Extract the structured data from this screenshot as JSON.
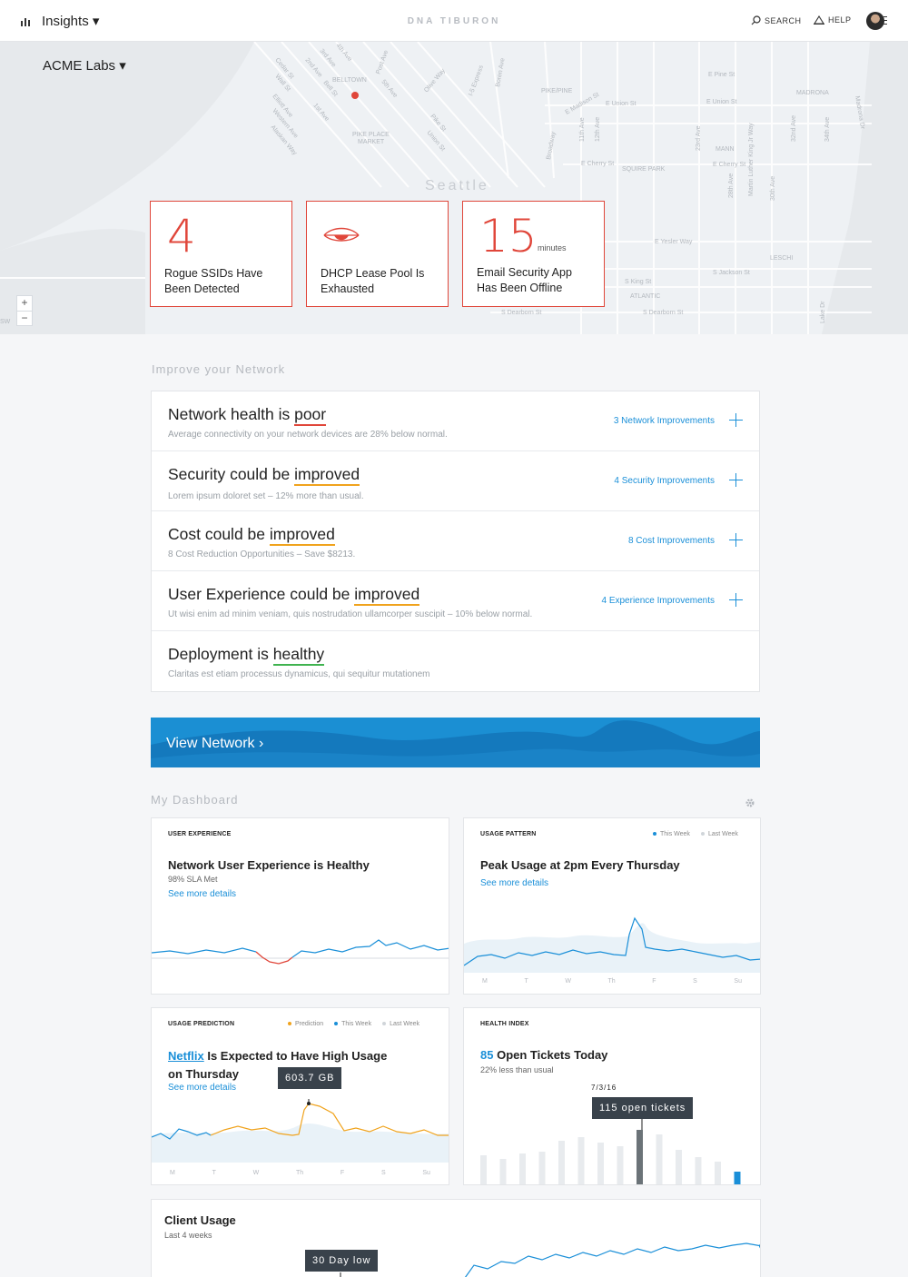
{
  "header": {
    "app_title": "Insights ▾",
    "brand": "DNA TIBURON",
    "search_label": "SEARCH",
    "help_label": "HELP"
  },
  "map": {
    "org_selector": "ACME Labs ▾",
    "city_label": "Seattle",
    "zoom_in": "+",
    "zoom_out": "−",
    "edge_label": "SW",
    "street_labels": [
      "Bell St",
      "Wall St",
      "Cedar St",
      "Elliott Ave",
      "Western Ave",
      "Alaskan Way",
      "1st Ave",
      "2nd Ave",
      "3rd Ave",
      "4th Ave",
      "5th Ave",
      "BELLTOWN",
      "PIKE PLACE MARKET",
      "Pike St",
      "Union St",
      "Post Ave",
      "Olive Way",
      "I-5 Express",
      "Boren Ave",
      "PIKE/PINE",
      "E Madison St",
      "Broadway",
      "E Union St",
      "E Pine St",
      "11th Ave",
      "12th Ave",
      "E Cherry St",
      "SQUIRE PARK",
      "MANN",
      "MADRONA",
      "23rd Ave",
      "Martin Luther King Jr Way",
      "28th Ave",
      "30th Ave",
      "32nd Ave",
      "34th Ave",
      "Madrona Dr",
      "E Yesler Way",
      "LESCHI",
      "S King St",
      "S Jackson St",
      "ATLANTIC",
      "S Dearborn St",
      "Lake Dr"
    ]
  },
  "alerts": [
    {
      "value": "4",
      "unit": "",
      "text": "Rogue SSIDs Have Been Detected"
    },
    {
      "value": "",
      "unit": "",
      "text": "DHCP Lease Pool Is Exhausted"
    },
    {
      "value": "15",
      "unit": "minutes",
      "text": "Email Security App Has Been Offline"
    }
  ],
  "improve": {
    "section_label": "Improve your Network",
    "rows": [
      {
        "prefix": "Network health is ",
        "status": "poor",
        "sub": "Average connectivity on your network devices are 28% below normal.",
        "link": "3 Network Improvements"
      },
      {
        "prefix": "Security could be ",
        "status": "improved",
        "sub": "Lorem ipsum doloret set – 12% more than usual.",
        "link": "4 Security Improvements"
      },
      {
        "prefix": "Cost could be ",
        "status": "improved",
        "sub": "8 Cost Reduction Opportunities – Save $8213.",
        "link": "8 Cost Improvements"
      },
      {
        "prefix": "User Experience could be ",
        "status": "improved",
        "sub": "Ut wisi enim ad minim veniam, quis nostrudation ullamcorper suscipit – 10% below normal.",
        "link": "4 Experience Improvements"
      },
      {
        "prefix": "Deployment is ",
        "status": "healthy",
        "sub": "Claritas est etiam processus dynamicus, qui sequitur mutationem",
        "link": ""
      }
    ]
  },
  "view_network": {
    "label": "View Network  ›"
  },
  "dashboard": {
    "section_label": "My Dashboard",
    "days": [
      "M",
      "T",
      "W",
      "Th",
      "F",
      "S",
      "Su"
    ],
    "user_experience": {
      "kicker": "USER EXPERIENCE",
      "title": "Network User Experience is Healthy",
      "sub": "98% SLA Met",
      "more": "See more details"
    },
    "usage_pattern": {
      "kicker": "USAGE PATTERN",
      "legend_this_week": "This Week",
      "legend_last_week": "Last Week",
      "title": "Peak Usage at 2pm Every Thursday",
      "more": "See more details"
    },
    "usage_prediction": {
      "kicker": "USAGE PREDICTION",
      "legend_prediction": "Prediction",
      "legend_this_week": "This Week",
      "legend_last_week": "Last Week",
      "title_highlight": "Netflix",
      "title_rest": " Is Expected to Have High Usage",
      "title_line2": "on Thursday",
      "more": "See more details",
      "tooltip": "603.7 GB"
    },
    "health_index": {
      "kicker": "HEALTH INDEX",
      "title_value": "85",
      "title_rest": " Open Tickets Today",
      "sub": "22% less than usual",
      "date": "7/3/16",
      "tooltip": "115 open tickets"
    },
    "client_usage": {
      "title": "Client Usage",
      "sub": "Last 4 weeks",
      "tooltip": "30 Day low"
    }
  },
  "colors": {
    "alert_red": "#e0463a",
    "accent_blue": "#1a8fd8",
    "warning_orange": "#f0a31d",
    "healthy_green": "#3fb34f"
  },
  "chart_data": [
    {
      "type": "bar",
      "title": "Open tickets (Health Index)",
      "categories": [
        "1",
        "2",
        "3",
        "4",
        "5",
        "6",
        "7",
        "8",
        "9",
        "10",
        "11",
        "12",
        "13",
        "14"
      ],
      "values": [
        32,
        28,
        34,
        36,
        48,
        52,
        46,
        42,
        60,
        55,
        38,
        30,
        25,
        14
      ],
      "highlight_index": 8,
      "latest_index": 13
    }
  ]
}
